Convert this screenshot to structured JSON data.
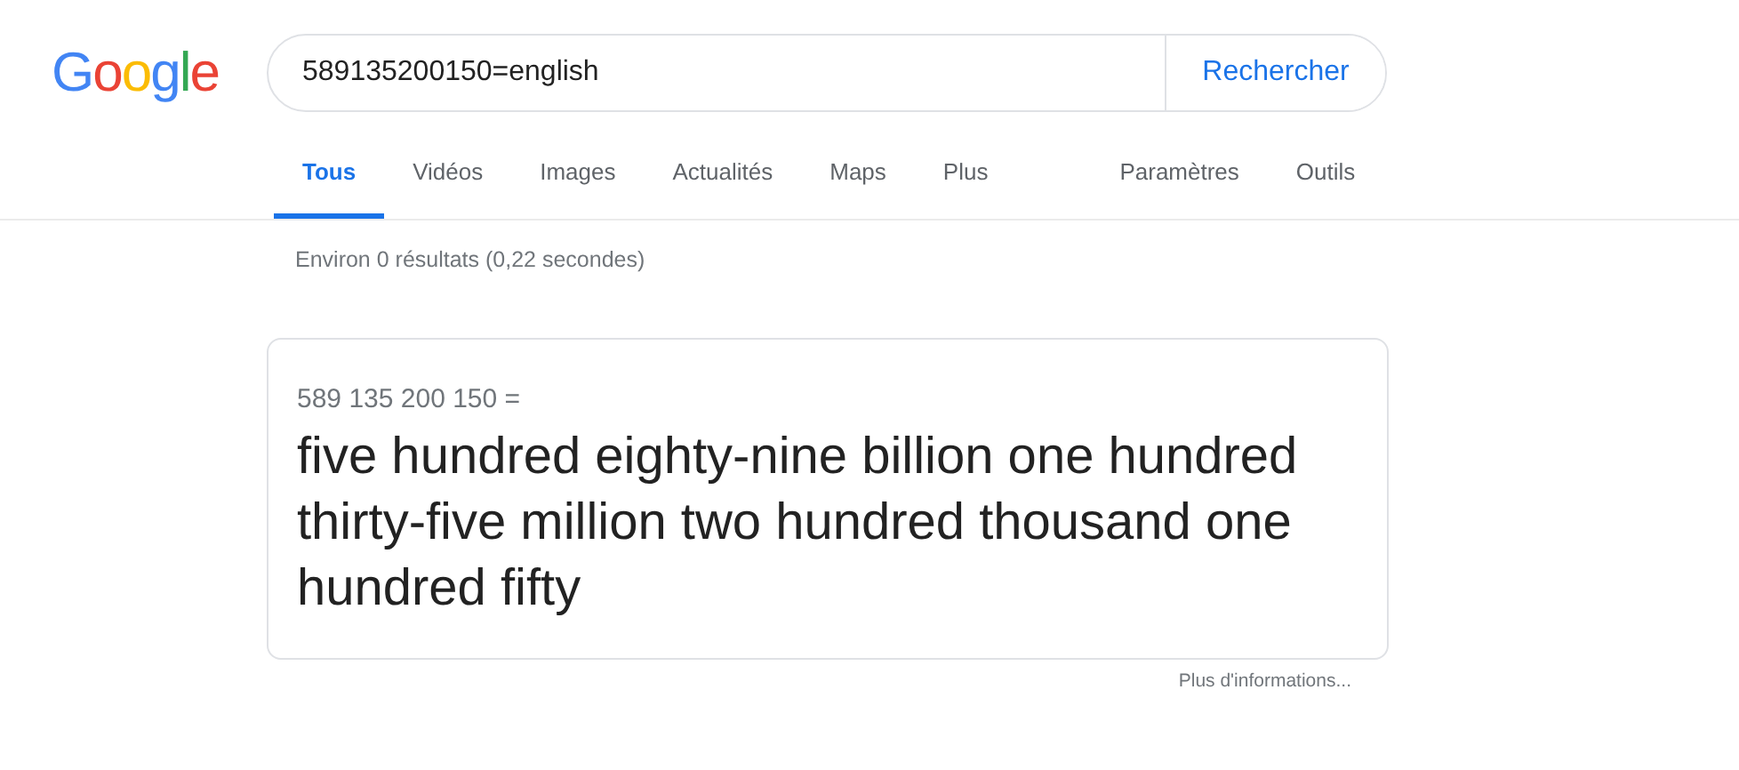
{
  "logo": {
    "letters": [
      {
        "char": "G",
        "color": "#4285f4"
      },
      {
        "char": "o",
        "color": "#ea4335"
      },
      {
        "char": "o",
        "color": "#fbbc05"
      },
      {
        "char": "g",
        "color": "#4285f4"
      },
      {
        "char": "l",
        "color": "#34a853"
      },
      {
        "char": "e",
        "color": "#ea4335"
      }
    ]
  },
  "search": {
    "value": "589135200150=english",
    "button": "Rechercher"
  },
  "tabs": [
    {
      "label": "Tous",
      "selected": true
    },
    {
      "label": "Vidéos",
      "selected": false
    },
    {
      "label": "Images",
      "selected": false
    },
    {
      "label": "Actualités",
      "selected": false
    },
    {
      "label": "Maps",
      "selected": false
    },
    {
      "label": "Plus",
      "selected": false
    }
  ],
  "tools": [
    "Paramètres",
    "Outils"
  ],
  "result_stats": "Environ 0 résultats (0,22 secondes)",
  "answer_card": {
    "expression": "589 135 200 150 =",
    "result": "five hundred eighty-nine billion one hundred thirty-five million two hundred thousand one hundred fifty"
  },
  "more_info": "Plus d'informations..."
}
